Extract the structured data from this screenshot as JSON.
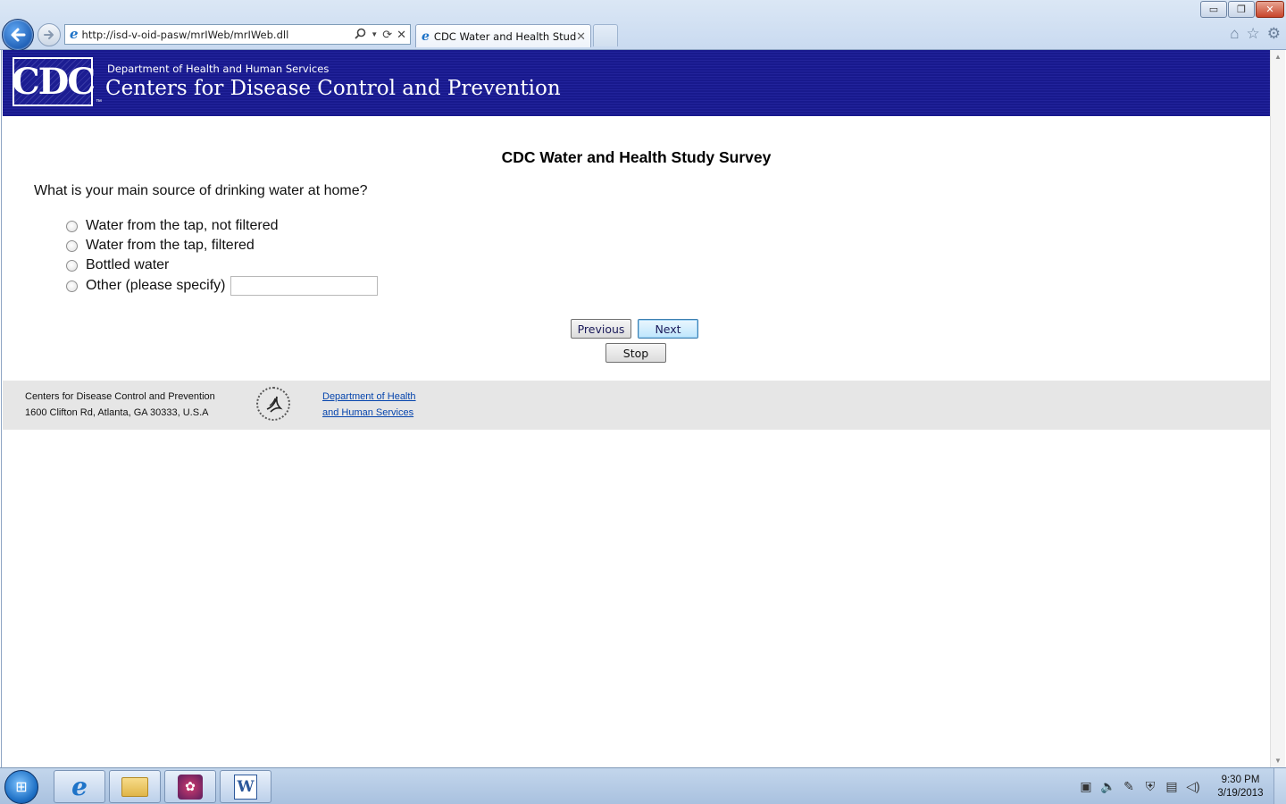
{
  "browser": {
    "address_url": "http://isd-v-oid-pasw/mrIWeb/mrIWeb.dll",
    "tab_title": "CDC Water and Health Study",
    "window_controls": {
      "minimize": "▭",
      "restore": "❐",
      "close": "✕"
    }
  },
  "banner": {
    "logo_text": "CDC",
    "trademark": "™",
    "department": "Department of Health and Human Services",
    "agency": "Centers for Disease Control and Prevention"
  },
  "survey": {
    "title": "CDC Water and Health Study Survey",
    "question": "What is your main source of drinking water at home?",
    "options": [
      {
        "label": "Water from the tap, not filtered"
      },
      {
        "label": "Water from the tap, filtered"
      },
      {
        "label": "Bottled water"
      },
      {
        "label": "Other (please specify)"
      }
    ],
    "other_value": "",
    "buttons": {
      "previous": "Previous",
      "next": "Next",
      "stop": "Stop"
    }
  },
  "footer": {
    "org_name": "Centers for Disease Control and Prevention",
    "address": "1600 Clifton Rd, Atlanta, GA 30333, U.S.A",
    "link_line1": "Department of Health",
    "link_line2": "and Human Services"
  },
  "taskbar": {
    "time": "9:30 PM",
    "date": "3/19/2013"
  }
}
